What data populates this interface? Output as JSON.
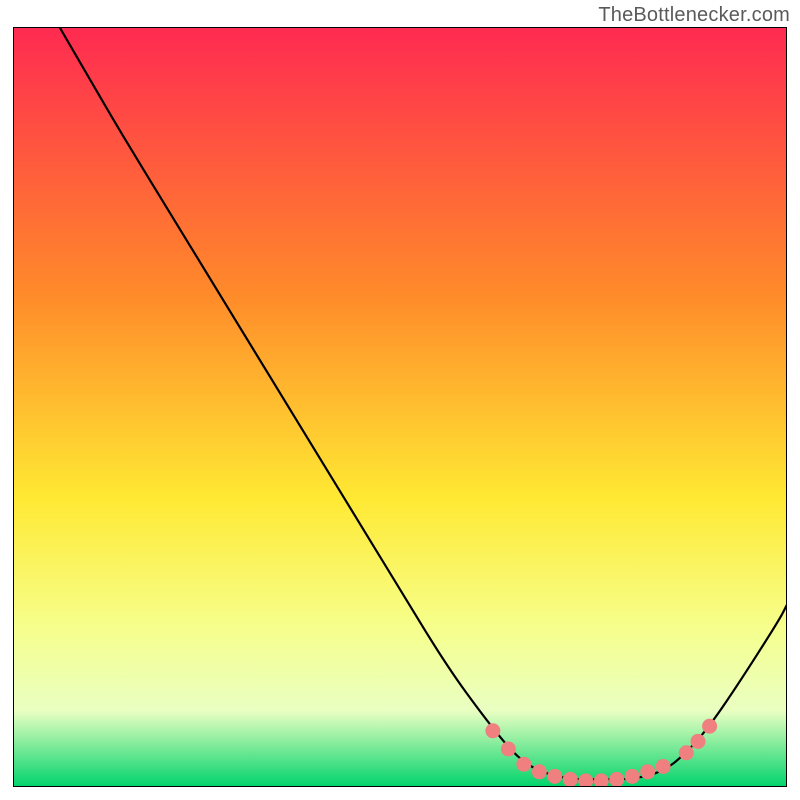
{
  "attribution": "TheBottlenecker.com",
  "colors": {
    "gradient_top": "#ff2a51",
    "gradient_mid_upper": "#ff8a2a",
    "gradient_mid": "#ffe933",
    "gradient_lower": "#f6ff8c",
    "gradient_band_pale": "#e9ffc2",
    "gradient_bottom": "#00d36b",
    "curve": "#000000",
    "dot_fill": "#f07f7f",
    "dot_stroke": "#d65b5b",
    "frame": "#000000"
  },
  "chart_data": {
    "type": "line",
    "title": "",
    "xlabel": "",
    "ylabel": "",
    "xlim": [
      0,
      100
    ],
    "ylim": [
      0,
      100
    ],
    "grid": false,
    "legend": false,
    "curve": {
      "name": "bottleneck-curve",
      "points": [
        {
          "x": 6,
          "y": 100
        },
        {
          "x": 10,
          "y": 93
        },
        {
          "x": 14,
          "y": 86
        },
        {
          "x": 20,
          "y": 76
        },
        {
          "x": 26,
          "y": 66
        },
        {
          "x": 32,
          "y": 56
        },
        {
          "x": 38,
          "y": 46
        },
        {
          "x": 44,
          "y": 36
        },
        {
          "x": 50,
          "y": 26
        },
        {
          "x": 56,
          "y": 16
        },
        {
          "x": 61,
          "y": 9
        },
        {
          "x": 65,
          "y": 4
        },
        {
          "x": 68,
          "y": 2
        },
        {
          "x": 72,
          "y": 1
        },
        {
          "x": 76,
          "y": 1
        },
        {
          "x": 80,
          "y": 1
        },
        {
          "x": 84,
          "y": 2
        },
        {
          "x": 87,
          "y": 4.5
        },
        {
          "x": 90,
          "y": 8
        },
        {
          "x": 94,
          "y": 14
        },
        {
          "x": 99,
          "y": 22
        },
        {
          "x": 100,
          "y": 24
        }
      ]
    },
    "optimal_markers": {
      "name": "optimal-range-dots",
      "points": [
        {
          "x": 62,
          "y": 7.4
        },
        {
          "x": 64,
          "y": 5.0
        },
        {
          "x": 66,
          "y": 3.0
        },
        {
          "x": 68,
          "y": 2.0
        },
        {
          "x": 70,
          "y": 1.4
        },
        {
          "x": 72,
          "y": 1.0
        },
        {
          "x": 74,
          "y": 0.8
        },
        {
          "x": 76,
          "y": 0.8
        },
        {
          "x": 78,
          "y": 1.0
        },
        {
          "x": 80,
          "y": 1.4
        },
        {
          "x": 82,
          "y": 2.0
        },
        {
          "x": 84,
          "y": 2.7
        },
        {
          "x": 87,
          "y": 4.5
        },
        {
          "x": 88.5,
          "y": 6.0
        },
        {
          "x": 90,
          "y": 8.0
        }
      ]
    }
  }
}
